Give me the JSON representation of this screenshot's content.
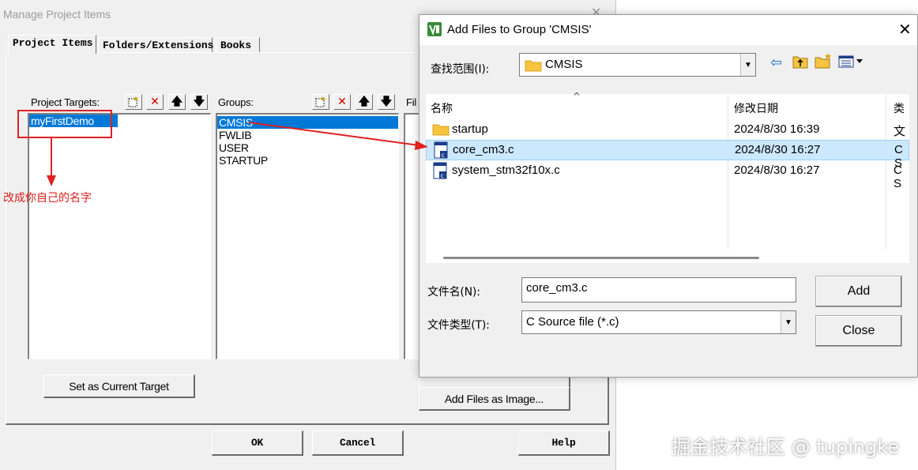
{
  "manage_window": {
    "title": "Manage Project Items",
    "tabs": [
      "Project Items",
      "Folders/Extensions",
      "Books"
    ],
    "targets_header": "Project Targets:",
    "groups_header": "Groups:",
    "files_header": "Fil",
    "targets": [
      {
        "label": "myFirstDemo",
        "selected": true
      }
    ],
    "groups": [
      {
        "label": "CMSIS",
        "selected": true
      },
      {
        "label": "FWLIB",
        "selected": false
      },
      {
        "label": "USER",
        "selected": false
      },
      {
        "label": "STARTUP",
        "selected": false
      }
    ],
    "set_current_target_label": "Set as Current Target",
    "add_files_image_label": "Add Files as Image...",
    "ok_label": "OK",
    "cancel_label": "Cancel",
    "help_label": "Help"
  },
  "annotation": {
    "text": "改成你自己的名字",
    "color": "#e02020"
  },
  "add_dialog": {
    "title": "Add Files to Group 'CMSIS'",
    "look_in_label": "查找范围(I):",
    "look_in_value": "CMSIS",
    "columns": {
      "name": "名称",
      "modified": "修改日期",
      "type": "类"
    },
    "files": [
      {
        "name": "startup",
        "modified": "2024/8/30 16:39",
        "type": "文",
        "icon": "folder-icon",
        "selected": false
      },
      {
        "name": "core_cm3.c",
        "modified": "2024/8/30 16:27",
        "type": "C S",
        "icon": "c-file-icon",
        "selected": true
      },
      {
        "name": "system_stm32f10x.c",
        "modified": "2024/8/30 16:27",
        "type": "C S",
        "icon": "c-file-icon",
        "selected": false
      }
    ],
    "filename_label": "文件名(N):",
    "filename_value": "core_cm3.c",
    "filetype_label": "文件类型(T):",
    "filetype_value": "C Source file (*.c)",
    "add_label": "Add",
    "close_label": "Close"
  },
  "watermark": "掘金技术社区 @ tupingke",
  "colors": {
    "selection": "#0078d7",
    "file_selection": "#cce8ff",
    "annotation_red": "#e02020",
    "window_bg": "#f0f0f0"
  }
}
